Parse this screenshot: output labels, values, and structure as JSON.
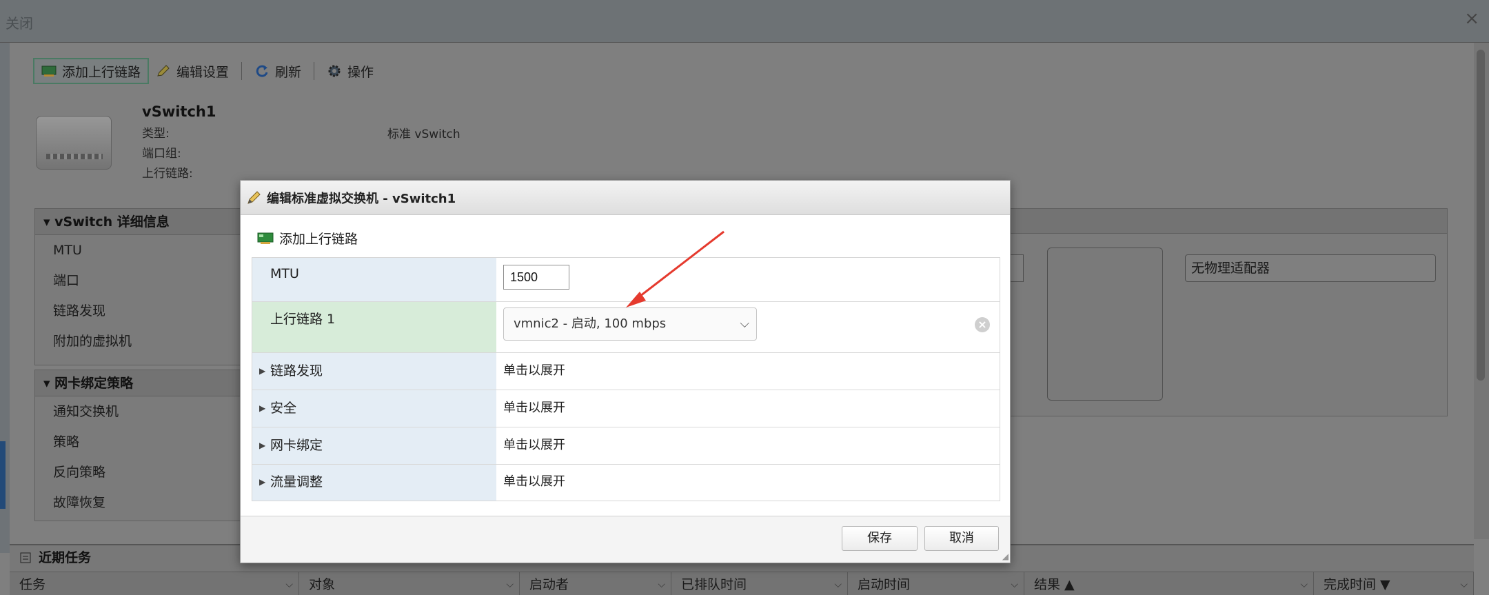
{
  "window": {
    "title": "关闭",
    "close_icon": "×"
  },
  "toolbar": {
    "add_uplink": "添加上行链路",
    "edit_settings": "编辑设置",
    "refresh": "刷新",
    "actions": "操作"
  },
  "vswitch": {
    "name": "vSwitch1",
    "type_label": "类型:",
    "type_value": "标准 vSwitch",
    "portgroup_label": "端口组:",
    "uplink_label": "上行链路:"
  },
  "details_panel": {
    "title": "vSwitch 详细信息",
    "rows": [
      "MTU",
      "端口",
      "链路发现",
      "附加的虚拟机"
    ]
  },
  "nic_panel": {
    "title": "网卡绑定策略",
    "rows": [
      "通知交换机",
      "策略",
      "反向策略",
      "故障恢复"
    ]
  },
  "right_panel": {
    "no_adapter": "无物理适配器"
  },
  "tasks": {
    "title": "近期任务",
    "columns": [
      "任务",
      "对象",
      "启动者",
      "已排队时间",
      "启动时间",
      "结果 ▲",
      "完成时间 ▼"
    ]
  },
  "modal": {
    "title": "编辑标准虚拟交换机 - vSwitch1",
    "add_uplink": "添加上行链路",
    "mtu_label": "MTU",
    "mtu_value": "1500",
    "uplink_label": "上行链路 1",
    "uplink_value": "vmnic2 - 启动, 100 mbps",
    "expand_rows": [
      {
        "label": "链路发现",
        "value": "单击以展开"
      },
      {
        "label": "安全",
        "value": "单击以展开"
      },
      {
        "label": "网卡绑定",
        "value": "单击以展开"
      },
      {
        "label": "流量调整",
        "value": "单击以展开"
      }
    ],
    "save": "保存",
    "cancel": "取消"
  },
  "colors": {
    "annotation_arrow": "#e53a2e",
    "uplink_row_bg": "#d7ecd9",
    "label_col_bg": "#e4edf5"
  },
  "icons": [
    "network-card-icon",
    "pencil-icon",
    "refresh-icon",
    "gear-icon",
    "chevron-down-icon",
    "clear-icon",
    "expand-triangle-icon"
  ]
}
